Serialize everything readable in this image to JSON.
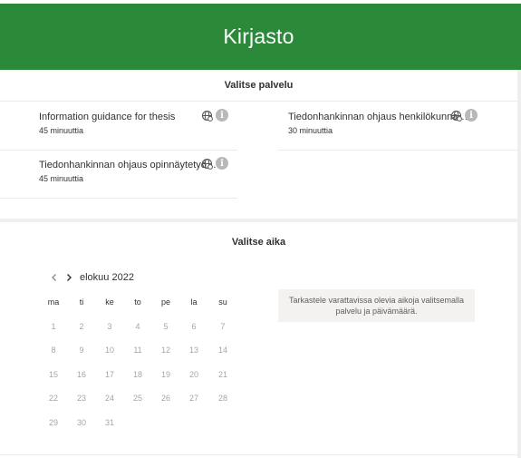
{
  "header": {
    "title": "Kirjasto"
  },
  "services_section": {
    "heading": "Valitse palvelu"
  },
  "services": [
    {
      "title": "Information guidance for thesis",
      "duration": "45 minuuttia"
    },
    {
      "title": "Tiedonhankinnan ohjaus henkilökunna…",
      "duration": "30 minuuttia"
    },
    {
      "title": "Tiedonhankinnan ohjaus opinnäytetyö…",
      "duration": "45 minuuttia"
    }
  ],
  "icons": {
    "online": "globe-icon",
    "details": "info-icon",
    "details_glyph": "i"
  },
  "time_section": {
    "heading": "Valitse aika"
  },
  "calendar": {
    "month_label": "elokuu 2022",
    "prev_glyph": "‹",
    "next_glyph": "›",
    "weekdays": [
      "ma",
      "ti",
      "ke",
      "to",
      "pe",
      "la",
      "su"
    ],
    "weeks": [
      [
        "1",
        "2",
        "3",
        "4",
        "5",
        "6",
        "7"
      ],
      [
        "8",
        "9",
        "10",
        "11",
        "12",
        "13",
        "14"
      ],
      [
        "15",
        "16",
        "17",
        "18",
        "19",
        "20",
        "21"
      ],
      [
        "22",
        "23",
        "24",
        "25",
        "26",
        "27",
        "28"
      ],
      [
        "29",
        "30",
        "31"
      ]
    ]
  },
  "hint": {
    "line1": "Tarkastele varattavissa olevia aikoja valitsemalla",
    "line2": "palvelu ja päivämäärä."
  },
  "colors": {
    "header_bg": "#2b8a3a",
    "header_text": "#ffffff",
    "disabled_day": "#a6a6a6"
  }
}
